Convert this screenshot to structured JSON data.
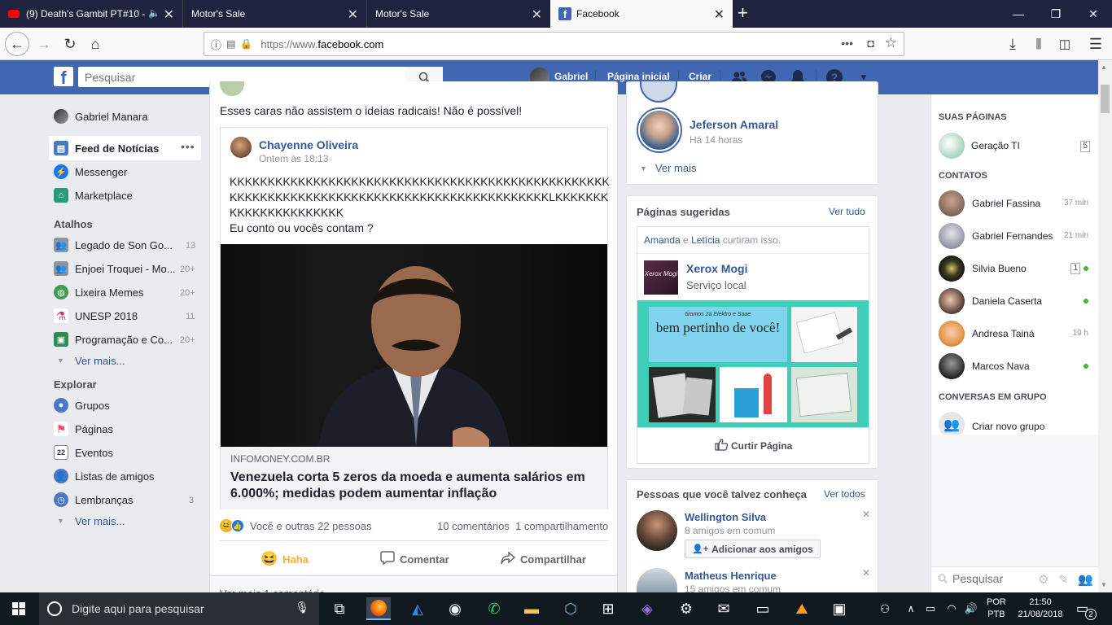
{
  "browser": {
    "tabs": [
      {
        "label": "(9) Death's Gambit PT#10 - (",
        "active": false
      },
      {
        "label": "Motor's Sale",
        "active": false
      },
      {
        "label": "Motor's Sale",
        "active": false
      },
      {
        "label": "Facebook",
        "active": true
      }
    ],
    "url": "https://www.facebook.com",
    "url_prefix": "https://www.",
    "url_domain": "facebook.com"
  },
  "fb_header": {
    "search_placeholder": "Pesquisar",
    "user_name": "Gabriel",
    "home_label": "Página inicial",
    "create_label": "Criar"
  },
  "left_nav": {
    "profile": "Gabriel Manara",
    "main": [
      {
        "label": "Feed de Notícias",
        "icon": "news-feed-icon"
      },
      {
        "label": "Messenger",
        "icon": "messenger-icon"
      },
      {
        "label": "Marketplace",
        "icon": "marketplace-icon"
      }
    ],
    "shortcuts_title": "Atalhos",
    "shortcuts": [
      {
        "label": "Legado de Son Go...",
        "count": "13"
      },
      {
        "label": "Enjoei Troquei - Mo...",
        "count": "20+"
      },
      {
        "label": "Lixeira Memes",
        "count": "20+"
      },
      {
        "label": "UNESP 2018",
        "count": "11"
      },
      {
        "label": "Programação e Co...",
        "count": "20+"
      }
    ],
    "see_more_1": "Ver mais...",
    "explore_title": "Explorar",
    "explore": [
      {
        "label": "Grupos",
        "count": ""
      },
      {
        "label": "Páginas",
        "count": ""
      },
      {
        "label": "Eventos",
        "count": ""
      },
      {
        "label": "Listas de amigos",
        "count": ""
      },
      {
        "label": "Lembranças",
        "count": "3"
      }
    ],
    "see_more_2": "Ver mais..."
  },
  "post": {
    "text": "Esses caras não assistem o ideias radicais! Não é possível!",
    "shared_author": "Chayenne Oliveira",
    "shared_time": "Ontem às 18:13",
    "shared_line1": "KKKKKKKKKKKKKKKKKKKKKKKKKKKKKKKKKKKKKKKKKKKKKKKKKK",
    "shared_line2": "KKKKKKKKKKKKKKKKKKKKKKKKKKKKKKKKKKKKKKKKKKLKKKKKKK",
    "shared_line3": "KKKKKKKKKKKKKKK",
    "shared_line4": "Eu conto ou vocês contam ?",
    "link_domain": "INFOMONEY.COM.BR",
    "link_title": "Venezuela corta 5 zeros da moeda e aumenta salários em 6.000%; medidas podem aumentar inflação",
    "reactions": "Você e outras 22 pessoas",
    "comments": "10 comentários",
    "shares": "1 compartilhamento",
    "action_haha": "Haha",
    "action_comment": "Comentar",
    "action_share": "Compartilhar",
    "see_more_comments": "Ver mais 1 comentário"
  },
  "right_rail": {
    "story_person": "Jeferson Amaral",
    "story_time": "Há 14 horas",
    "see_more": "Ver mais",
    "suggested_pages_title": "Páginas sugeridas",
    "see_all": "Ver tudo",
    "liked_by_1": "Amanda",
    "liked_by_and": "e",
    "liked_by_2": "Letícia",
    "liked_by_suffix": "curtiram isso.",
    "page_name": "Xerox Mogi",
    "page_category": "Serviço local",
    "page_thumb_text": "Xerox Mogi",
    "banner_small": "tiramos 2a Elektro e Saae",
    "banner_main": "bem pertinho de você!",
    "like_page": "Curtir Página",
    "pymk_title": "Pessoas que você talvez conheça",
    "pymk_see_all": "Ver todos",
    "pymk": [
      {
        "name": "Wellington Silva",
        "mutual": "8 amigos em comum",
        "add": "Adicionar aos amigos"
      },
      {
        "name": "Matheus Henrique",
        "mutual": "15 amigos em comum"
      }
    ]
  },
  "chat": {
    "pages_title": "SUAS PÁGINAS",
    "page": {
      "name": "Geração TI",
      "count": "5"
    },
    "contacts_title": "CONTATOS",
    "contacts": [
      {
        "name": "Gabriel Fassina",
        "time": "37 min",
        "online": false,
        "badge": ""
      },
      {
        "name": "Gabriel Fernandes",
        "time": "21 min",
        "online": false,
        "badge": ""
      },
      {
        "name": "Silvia Bueno",
        "time": "",
        "online": true,
        "badge": "1"
      },
      {
        "name": "Daniela Caserta",
        "time": "",
        "online": true,
        "badge": ""
      },
      {
        "name": "Andresa Tainá",
        "time": "19 h",
        "online": false,
        "badge": ""
      },
      {
        "name": "Marcos Nava",
        "time": "",
        "online": true,
        "badge": ""
      }
    ],
    "groups_title": "CONVERSAS EM GRUPO",
    "new_group": "Criar novo grupo",
    "search_placeholder": "Pesquisar"
  },
  "taskbar": {
    "search_placeholder": "Digite aqui para pesquisar",
    "lang1": "POR",
    "lang2": "PTB",
    "time": "21:50",
    "date": "21/08/2018",
    "notif_count": "2"
  },
  "colors": {
    "fb_blue": "#4267b2",
    "link_blue": "#365899",
    "online_green": "#42b72a",
    "haha_yellow": "#f7b125"
  }
}
